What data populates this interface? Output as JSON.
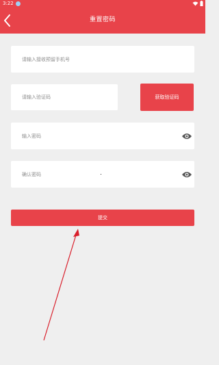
{
  "status_bar": {
    "time": "3:22"
  },
  "header": {
    "title": "重置密码"
  },
  "form": {
    "phone_placeholder": "请输入接收预留手机号",
    "code_placeholder": "请输入验证码",
    "get_code_label": "获取验证码",
    "password_placeholder": "输入密码",
    "confirm_placeholder": "确认密码",
    "submit_label": "提交"
  },
  "colors": {
    "accent": "#e8434a",
    "background": "#efefef",
    "arrow": "#d91f2b"
  },
  "icons": [
    "back-chevron",
    "eye-icon",
    "wifi-icon",
    "battery-icon"
  ]
}
